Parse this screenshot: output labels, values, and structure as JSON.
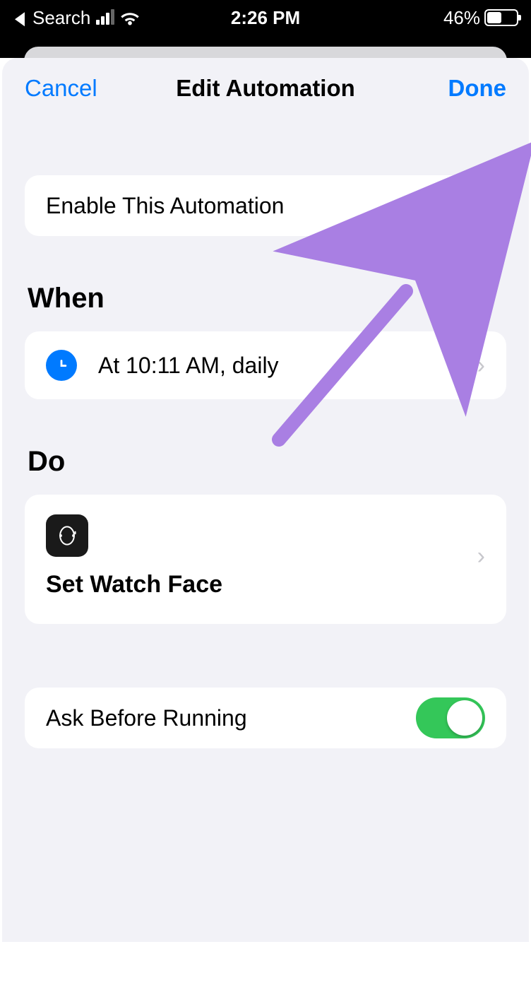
{
  "status": {
    "back_label": "Search",
    "time": "2:26 PM",
    "battery_percent": "46%"
  },
  "nav": {
    "cancel": "Cancel",
    "title": "Edit Automation",
    "done": "Done"
  },
  "enable": {
    "label": "Enable This Automation",
    "on": true
  },
  "when": {
    "header": "When",
    "trigger_label": "At 10:11 AM, daily"
  },
  "do": {
    "header": "Do",
    "action_title": "Set Watch Face"
  },
  "ask": {
    "label": "Ask Before Running",
    "on": true
  }
}
